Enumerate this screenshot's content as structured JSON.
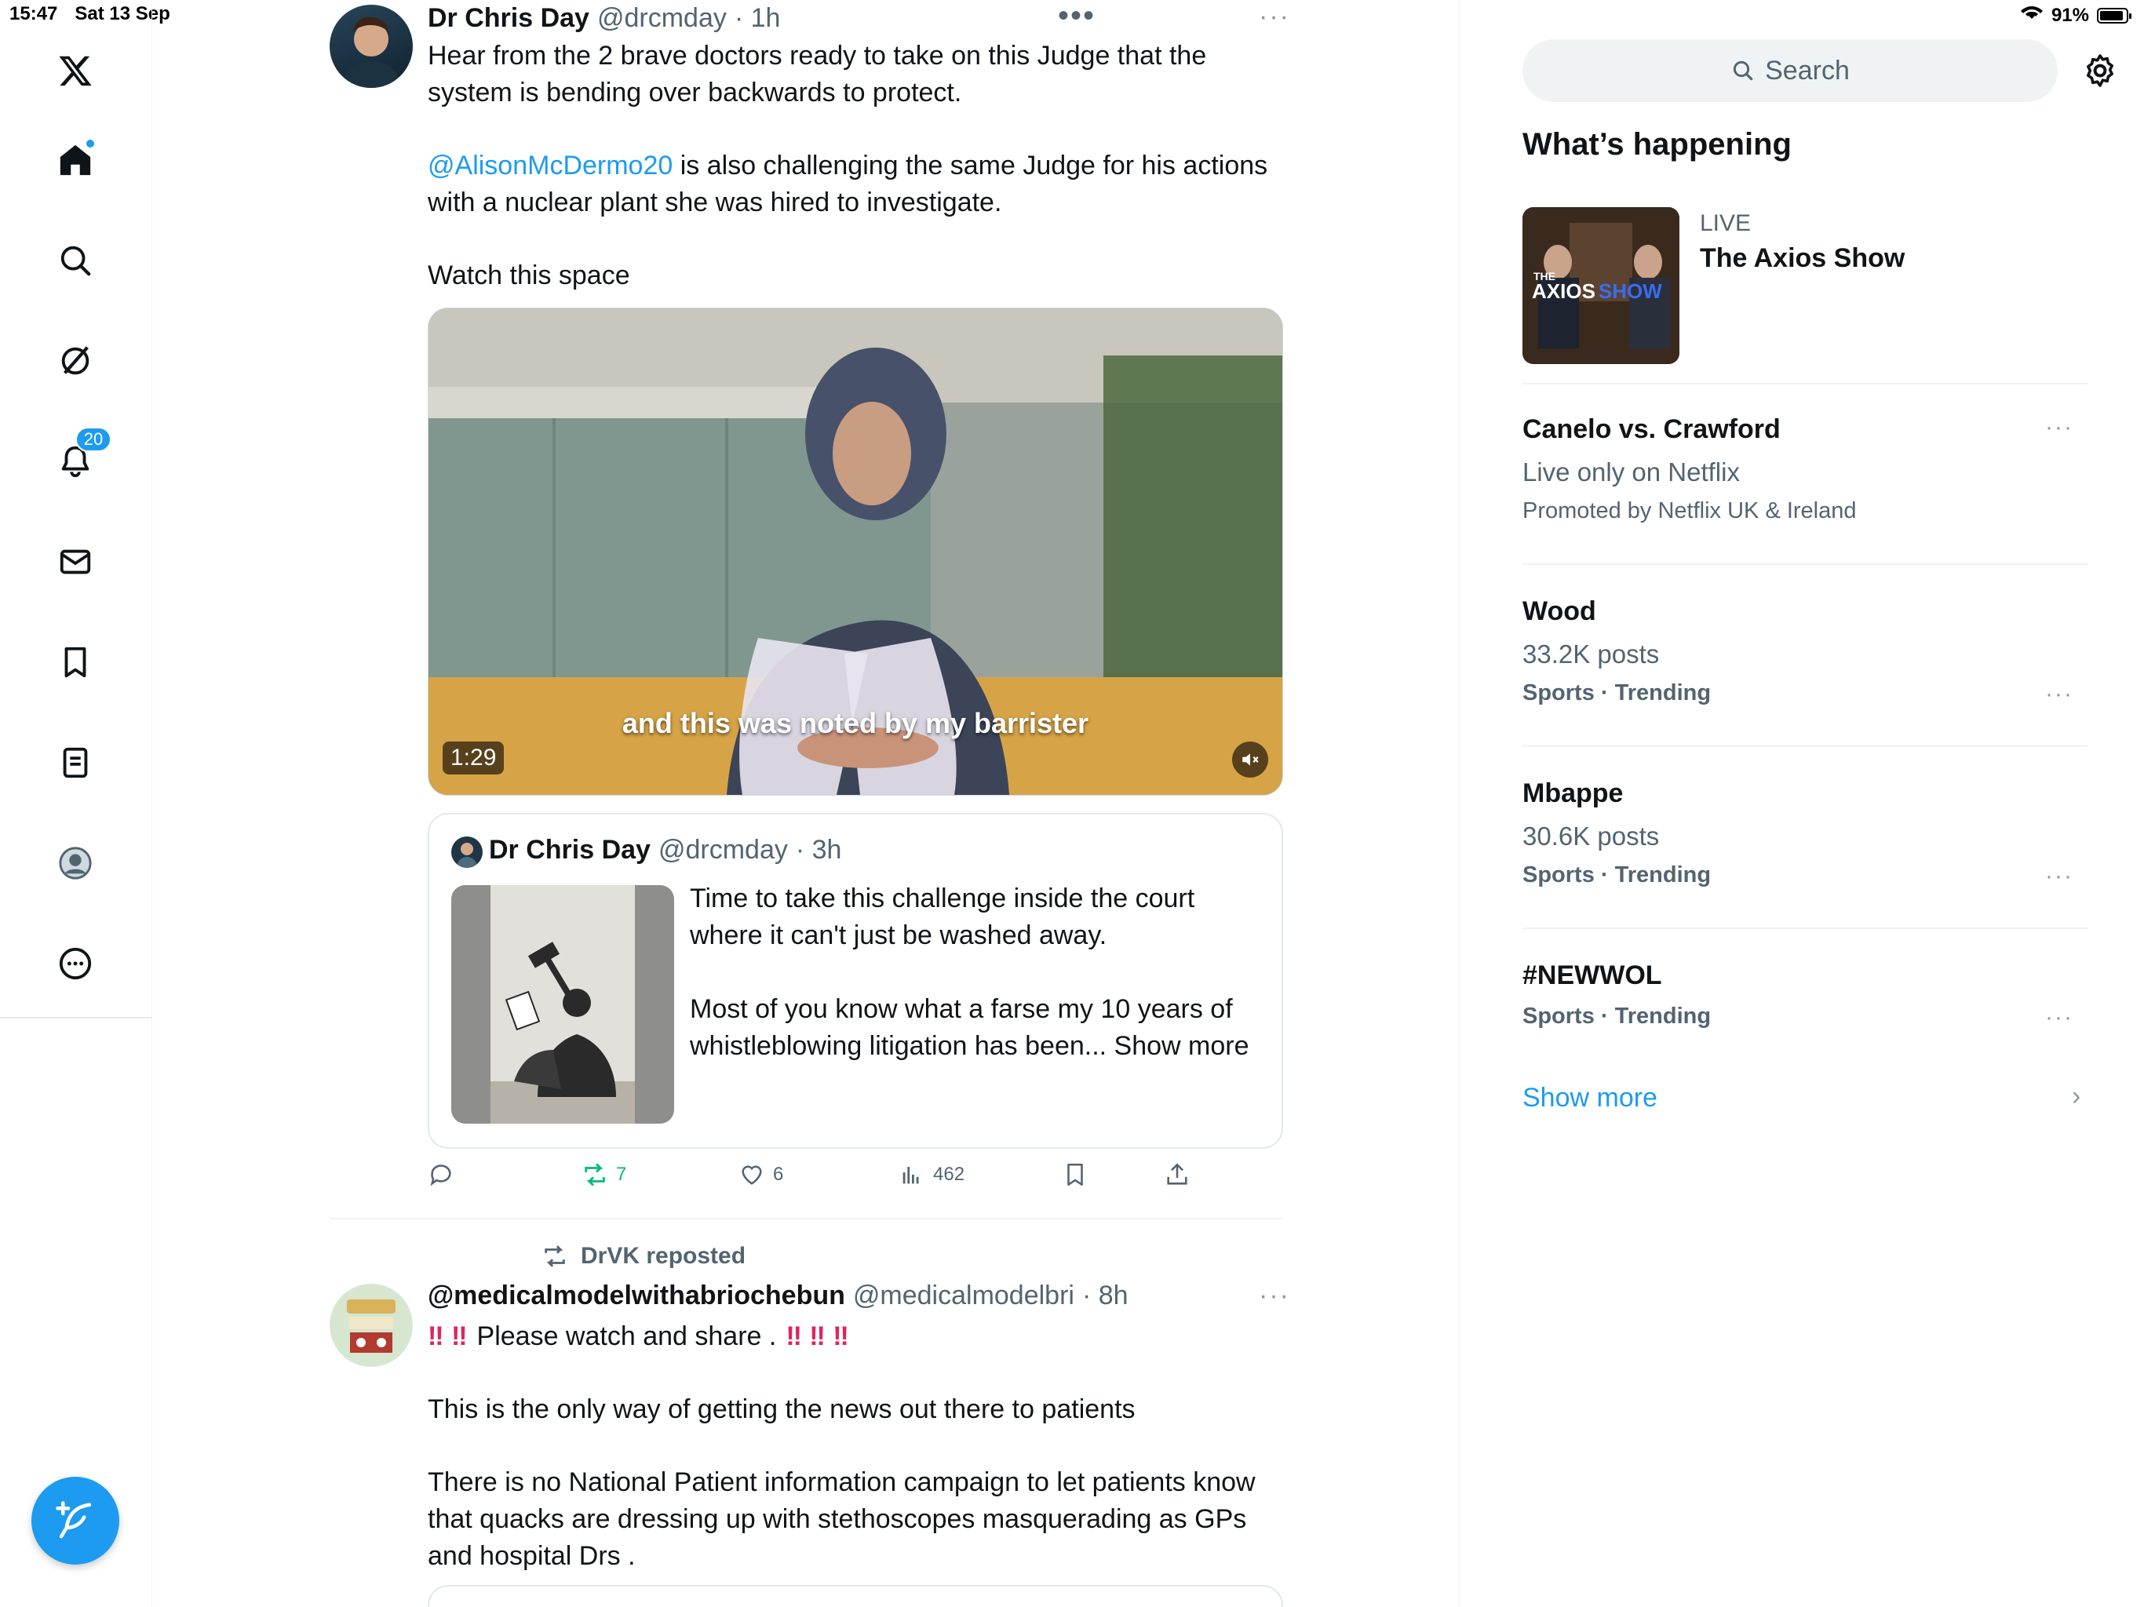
{
  "status_bar": {
    "time": "15:47",
    "date": "Sat 13 Sep",
    "battery": "91%",
    "battery_level": 0.91
  },
  "sidebar": {
    "notifications_badge": "20",
    "items": [
      "home",
      "explore",
      "grok",
      "notifications",
      "messages",
      "bookmarks",
      "lists",
      "profile",
      "more"
    ]
  },
  "post1": {
    "name": "Dr Chris Day",
    "handle": "@drcmday",
    "time": "· 1h",
    "text_a": "Hear from the 2 brave doctors ready to take on this Judge that the\nsystem is bending over backwards to protect.",
    "mention": "@AlisonMcDermo20",
    "text_b": " is also challenging the same Judge for his actions\nwith a nuclear plant she was hired to investigate.",
    "text_c": "Watch this space",
    "video_caption": "and this was noted by my barrister",
    "video_duration": "1:29",
    "quote": {
      "name": "Dr Chris Day",
      "handle": "@drcmday",
      "time": "· 3h",
      "text": "Time to take this challenge inside the court\nwhere it can't just be washed away.\n\nMost of you know what a farse my 10 years of\nwhistleblowing litigation has been...",
      "show_more": " Show more"
    },
    "actions": {
      "replies": "",
      "reposts": "7",
      "likes": "6",
      "views": "462"
    }
  },
  "post2": {
    "repost_label": "DrVK reposted",
    "name": "@medicalmodelwithabriochebun",
    "handle": "@medicalmodelbri",
    "time": "· 8h",
    "line1": "Please watch and share .",
    "line2": "This is the only way of getting the news out there to patients",
    "line3": "There is no National Patient information campaign to let patients know\nthat quacks are dressing up with stethoscopes masquerading as GPs\nand hospital Drs ."
  },
  "right": {
    "search_placeholder": "Search",
    "heading": "What’s happening",
    "live": {
      "label": "LIVE",
      "title": "The Axios Show",
      "thumb_text": "AXIOS",
      "thumb_small": "THE",
      "thumb_accent": "SHOW"
    },
    "trends": [
      {
        "title": "Canelo vs. Crawford",
        "sub": "Live only on Netflix",
        "meta": "Promoted by Netflix UK & Ireland"
      },
      {
        "title": "Wood",
        "sub": "33.2K posts",
        "meta": "Sports · Trending"
      },
      {
        "title": "Mbappe",
        "sub": "30.6K posts",
        "meta": "Sports · Trending"
      },
      {
        "title": "#NEWWOL",
        "sub": "",
        "meta": "Sports · Trending"
      }
    ],
    "show_more": "Show more"
  },
  "colors": {
    "accent": "#1d9bf0",
    "repost_green": "#00ba7c",
    "alert_red": "#e0245e"
  }
}
